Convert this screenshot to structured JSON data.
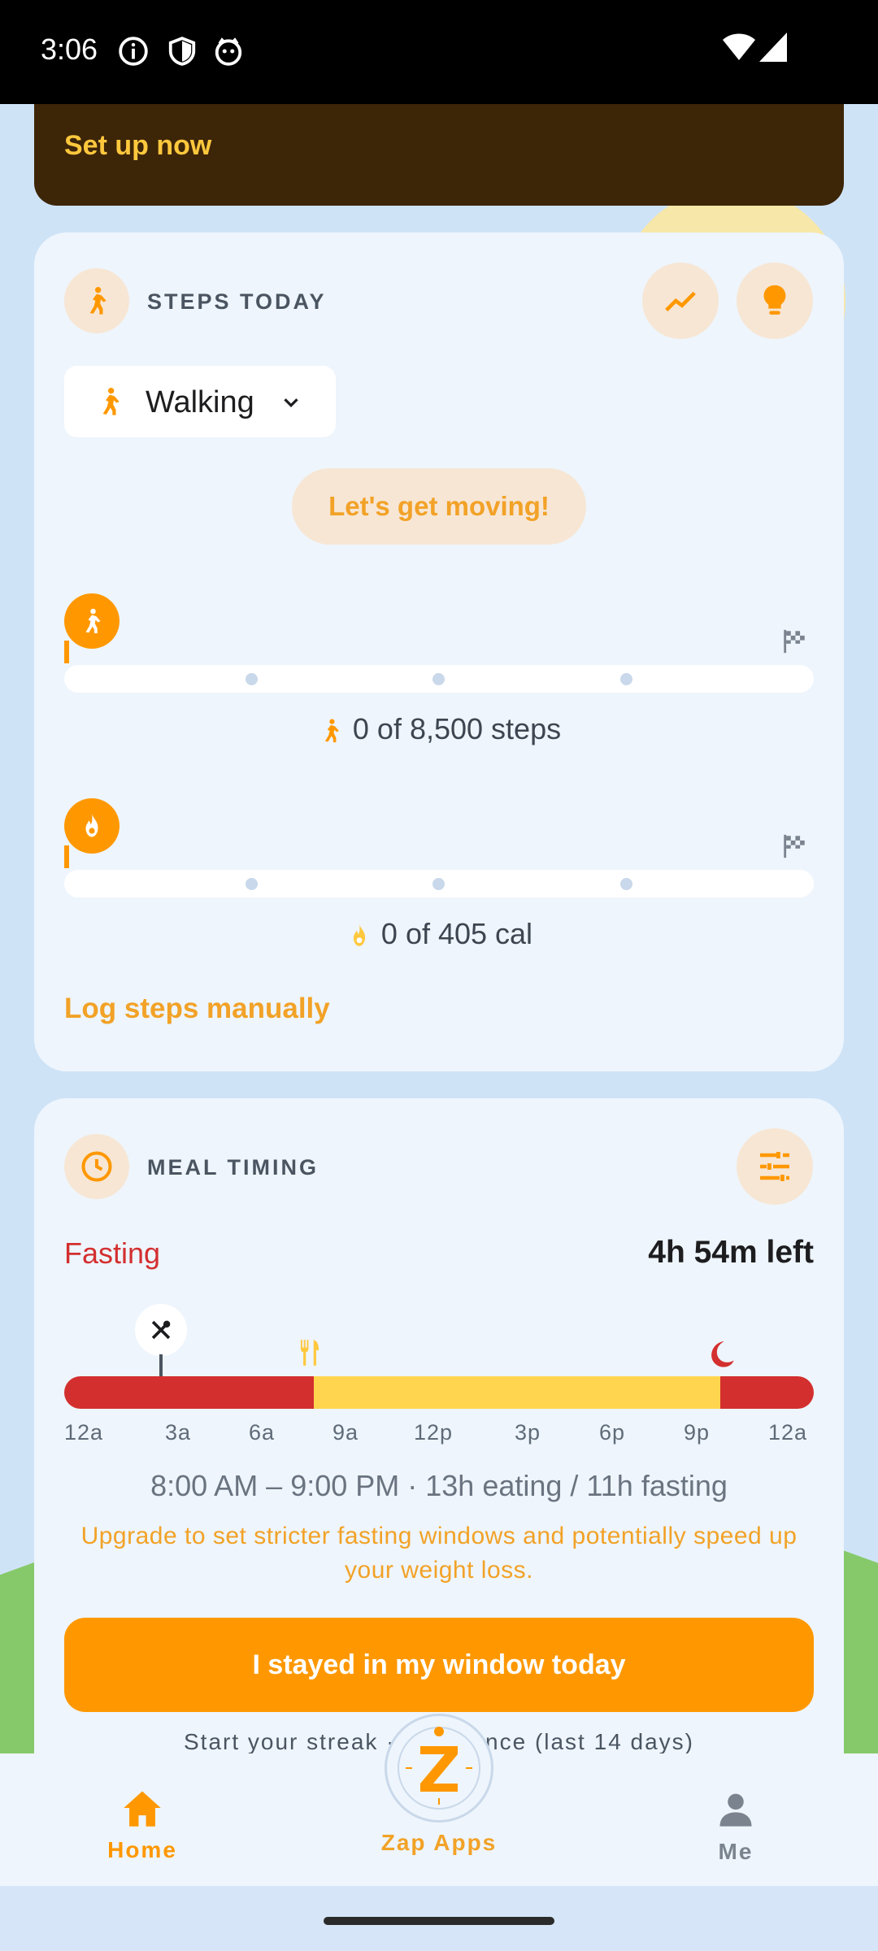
{
  "status_bar": {
    "time": "3:06"
  },
  "promo": {
    "cta": "Set up now"
  },
  "steps": {
    "title": "STEPS TODAY",
    "activity": "Walking",
    "motivation": "Let's get moving!",
    "steps_progress": 0,
    "steps_text": "0 of 8,500 steps",
    "calories_progress": 0,
    "calories_text": "0 of 405 cal",
    "log_link": "Log steps manually"
  },
  "meal": {
    "title": "MEAL TIMING",
    "status": "Fasting",
    "time_left": "4h 54m left",
    "hour_labels": [
      "12a",
      "3a",
      "6a",
      "9a",
      "12p",
      "3p",
      "6p",
      "9p",
      "12a"
    ],
    "eating_start_hour": 8,
    "eating_end_hour": 21,
    "window_text": "8:00 AM – 9:00 PM  ·  13h eating / 11h fasting",
    "upgrade_text": "Upgrade to set stricter fasting windows and potentially speed up your weight loss.",
    "stay_button": "I stayed in my window today",
    "streak_text": "Start your streak  ·  Adherence (last 14 days)"
  },
  "nav": {
    "home": "Home",
    "zap": "Zap Apps",
    "me": "Me"
  },
  "colors": {
    "accent": "#ff9800",
    "fasting": "#d32f2f",
    "eating": "#ffd54f"
  }
}
